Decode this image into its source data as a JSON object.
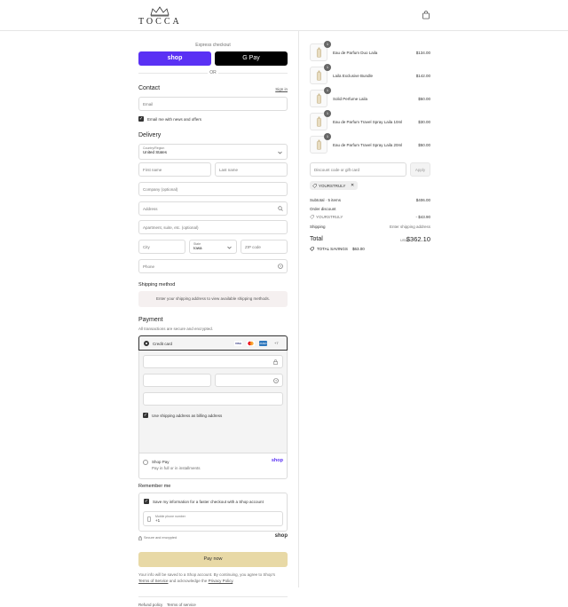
{
  "brand": {
    "name": "TOCCA"
  },
  "express": {
    "label": "Express checkout",
    "shop_label": "shop",
    "gpay_label": "G Pay",
    "or_label": "OR"
  },
  "contact": {
    "title": "Contact",
    "sign_in": "Sign in",
    "email_placeholder": "Email",
    "news_label": "Email me with news and offers"
  },
  "delivery": {
    "title": "Delivery",
    "country_label": "Country/Region",
    "country_value": "United States",
    "first_name": "First name",
    "last_name": "Last name",
    "company": "Company (optional)",
    "address": "Address",
    "apartment": "Apartment, suite, etc. (optional)",
    "city": "City",
    "state_label": "State",
    "state_value": "Iowa",
    "zip": "ZIP code",
    "phone": "Phone"
  },
  "shipping": {
    "title": "Shipping method",
    "notice": "Enter your shipping address to view available shipping methods."
  },
  "payment": {
    "title": "Payment",
    "subtitle": "All transactions are secure and encrypted.",
    "credit_card": "Credit card",
    "card_brands": [
      "VISA",
      "MC",
      "AMEX",
      "+7"
    ],
    "billing_label": "Use shipping address as billing address",
    "shop_pay": "Shop Pay",
    "shop_pay_sub": "Pay in full or in installments",
    "shop_pay_logo": "shop"
  },
  "remember": {
    "title": "Remember me",
    "save_label": "Save my information for a faster checkout with a Shop account",
    "mobile_label": "Mobile phone number",
    "mobile_value": "+1",
    "secure": "Secure and encrypted",
    "shop_logo": "shop"
  },
  "pay_now": "Pay now",
  "legal": {
    "text1": "Your info will be saved to a Shop account. By continuing, you agree to Shop's",
    "tos": "Terms of Service",
    "and": "and acknowledge the",
    "privacy": "Privacy Policy",
    "end": "."
  },
  "footer": {
    "refund": "Refund policy",
    "terms": "Terms of service"
  },
  "cart": {
    "items": [
      {
        "name": "Eau de Parfum Duo Laila",
        "price": "$134.00",
        "qty": "1"
      },
      {
        "name": "Laila Exclusive Bundle",
        "price": "$142.00",
        "qty": "1"
      },
      {
        "name": "Solid Perfume Laila",
        "price": "$50.00",
        "qty": "1"
      },
      {
        "name": "Eau de Parfum Travel Spray Laila 10ml",
        "price": "$30.00",
        "qty": "1"
      },
      {
        "name": "Eau de Parfum Travel Spray Laila 20ml",
        "price": "$50.00",
        "qty": "1"
      }
    ],
    "discount_placeholder": "Discount code or gift card",
    "apply": "Apply",
    "code": "YOURSTRULY",
    "subtotal_label": "Subtotal · 5 items",
    "subtotal_value": "$406.00",
    "order_discount": "Order discount",
    "discount_code": "YOURSTRULY",
    "discount_value": "- $43.90",
    "shipping_label": "Shipping",
    "shipping_value": "Enter shipping address",
    "total_label": "Total",
    "currency": "USD",
    "total_value": "$362.10",
    "savings_label": "TOTAL SAVINGS",
    "savings_value": "$63.00"
  }
}
